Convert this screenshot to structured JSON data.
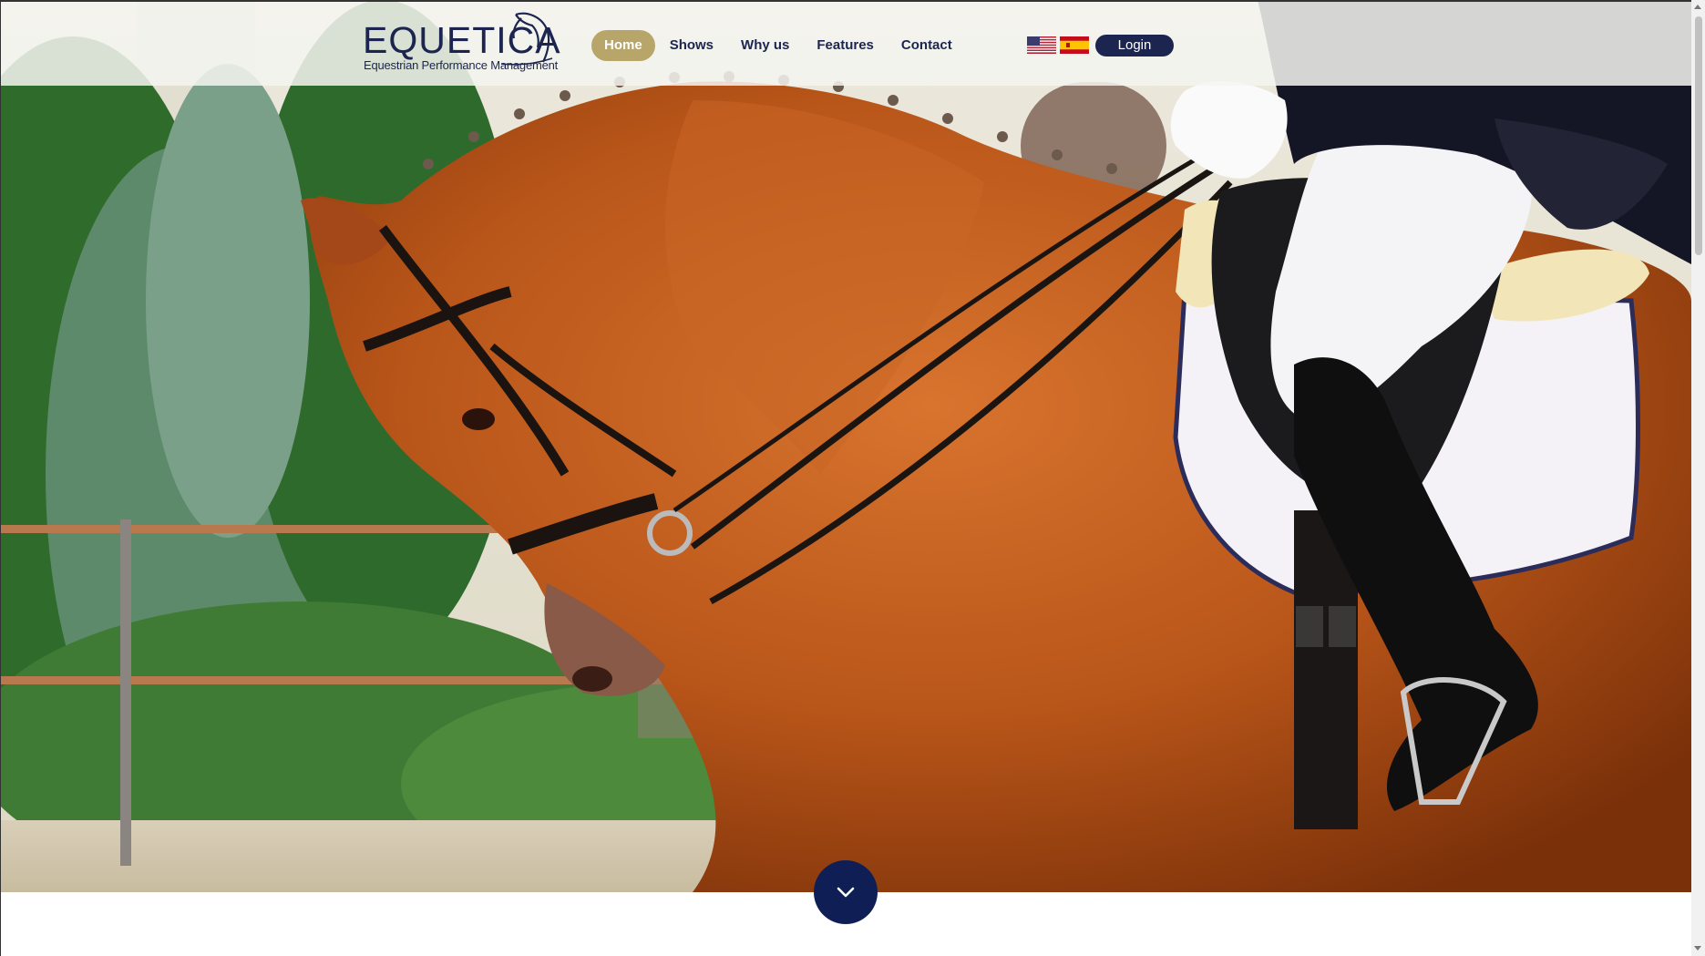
{
  "logo": {
    "word": "EQUETICA",
    "tagline": "Equestrian Performance Management",
    "icon": "horse-head-icon"
  },
  "nav": {
    "items": [
      {
        "label": "Home",
        "active": true
      },
      {
        "label": "Shows",
        "active": false
      },
      {
        "label": "Why us",
        "active": false
      },
      {
        "label": "Features",
        "active": false
      },
      {
        "label": "Contact",
        "active": false
      }
    ]
  },
  "languages": [
    {
      "icon": "us-flag-icon"
    },
    {
      "icon": "spain-flag-icon"
    }
  ],
  "login": {
    "label": "Login"
  },
  "hero": {
    "scroll_icon": "chevron-down-icon"
  },
  "colors": {
    "brand_navy": "#1c2550",
    "accent_gold": "#b8a56a",
    "scroll_button": "#0f1f55"
  }
}
